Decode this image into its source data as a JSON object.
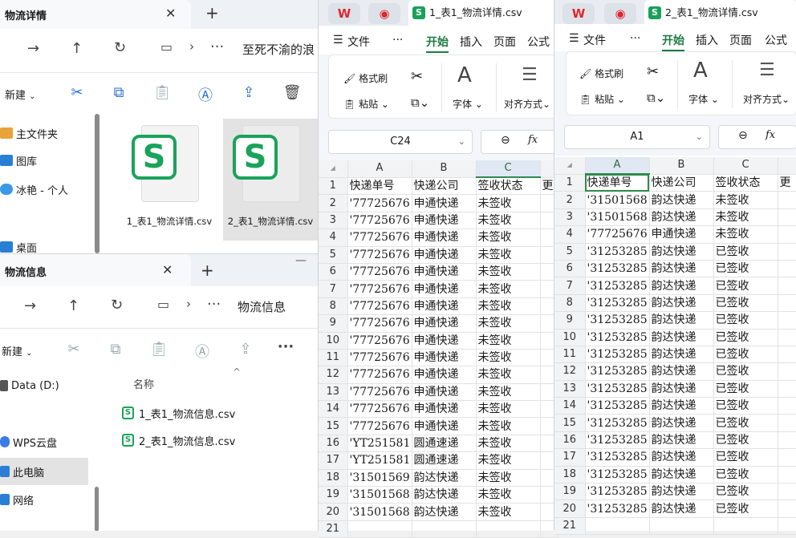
{
  "explorer1": {
    "tab_title": "物流详情",
    "address_path": "至死不渝的浪",
    "new_label": "新建",
    "sidebar": [
      {
        "label": "主文件夹",
        "icon": "home-icon"
      },
      {
        "label": "图库",
        "icon": "gallery-icon"
      },
      {
        "label": "冰艳 - 个人",
        "icon": "cloud-icon"
      },
      {
        "label": "桌面",
        "icon": "desktop-icon"
      }
    ],
    "files": [
      {
        "name": "1_表1_物流详情.csv"
      },
      {
        "name": "2_表1_物流详情.csv"
      }
    ]
  },
  "explorer2": {
    "tab_title": "物流信息",
    "address_path": "物流信息",
    "new_label": "新建",
    "column_name": "名称",
    "sidebar": [
      {
        "label": "Data (D:)",
        "icon": "drive-icon"
      },
      {
        "label": "WPS云盘",
        "icon": "cloud-icon"
      },
      {
        "label": "此电脑",
        "icon": "pc-icon"
      },
      {
        "label": "网络",
        "icon": "network-icon"
      }
    ],
    "files": [
      {
        "name": "1_表1_物流信息.csv"
      },
      {
        "name": "2_表1_物流信息.csv"
      }
    ]
  },
  "sheet1": {
    "tab_title": "1_表1_物流详情.csv",
    "menus": [
      "文件",
      "开始",
      "插入",
      "页面",
      "公式"
    ],
    "ribbon": {
      "format_painter": "格式刷",
      "paste": "粘贴",
      "font": "字体",
      "align": "对齐方式"
    },
    "name_box": "C24",
    "fx": "fx",
    "columns": [
      "A",
      "B",
      "C"
    ],
    "rows": [
      [
        "快递单号",
        "快递公司",
        "签收状态"
      ],
      [
        "'77725676",
        "申通快递",
        "未签收"
      ],
      [
        "'77725676",
        "申通快递",
        "未签收"
      ],
      [
        "'77725676",
        "申通快递",
        "未签收"
      ],
      [
        "'77725676",
        "申通快递",
        "未签收"
      ],
      [
        "'77725676",
        "申通快递",
        "未签收"
      ],
      [
        "'77725676",
        "申通快递",
        "未签收"
      ],
      [
        "'77725676",
        "申通快递",
        "未签收"
      ],
      [
        "'77725676",
        "申通快递",
        "未签收"
      ],
      [
        "'77725676",
        "申通快递",
        "未签收"
      ],
      [
        "'77725676",
        "申通快递",
        "未签收"
      ],
      [
        "'77725676",
        "申通快递",
        "未签收"
      ],
      [
        "'77725676",
        "申通快递",
        "未签收"
      ],
      [
        "'77725676",
        "申通快递",
        "未签收"
      ],
      [
        "'77725676",
        "申通快递",
        "未签收"
      ],
      [
        "'YT251581",
        "圆通速递",
        "未签收"
      ],
      [
        "'YT251581",
        "圆通速递",
        "未签收"
      ],
      [
        "'31501569",
        "韵达快递",
        "未签收"
      ],
      [
        "'31501568",
        "韵达快递",
        "未签收"
      ],
      [
        "'31501568",
        "韵达快递",
        "未签收"
      ],
      [
        "",
        "",
        ""
      ]
    ],
    "col_d_header": "更"
  },
  "sheet2": {
    "tab_title": "2_表1_物流详情.csv",
    "menus": [
      "文件",
      "开始",
      "插入",
      "页面",
      "公式"
    ],
    "ribbon": {
      "format_painter": "格式刷",
      "paste": "粘贴",
      "font": "字体",
      "align": "对齐方式"
    },
    "name_box": "A1",
    "fx": "fx",
    "columns": [
      "A",
      "B",
      "C"
    ],
    "rows": [
      [
        "快递单号",
        "快递公司",
        "签收状态"
      ],
      [
        "'31501568",
        "韵达快递",
        "未签收"
      ],
      [
        "'31501568",
        "韵达快递",
        "未签收"
      ],
      [
        "'77725676",
        "申通快递",
        "未签收"
      ],
      [
        "'31253285",
        "韵达快递",
        "已签收"
      ],
      [
        "'31253285",
        "韵达快递",
        "已签收"
      ],
      [
        "'31253285",
        "韵达快递",
        "已签收"
      ],
      [
        "'31253285",
        "韵达快递",
        "已签收"
      ],
      [
        "'31253285",
        "韵达快递",
        "已签收"
      ],
      [
        "'31253285",
        "韵达快递",
        "已签收"
      ],
      [
        "'31253285",
        "韵达快递",
        "已签收"
      ],
      [
        "'31253285",
        "韵达快递",
        "已签收"
      ],
      [
        "'31253285",
        "韵达快递",
        "已签收"
      ],
      [
        "'31253285",
        "韵达快递",
        "已签收"
      ],
      [
        "'31253285",
        "韵达快递",
        "已签收"
      ],
      [
        "'31253285",
        "韵达快递",
        "已签收"
      ],
      [
        "'31253285",
        "韵达快递",
        "已签收"
      ],
      [
        "'31253285",
        "韵达快递",
        "已签收"
      ],
      [
        "'31253285",
        "韵达快递",
        "已签收"
      ],
      [
        "'31253285",
        "韵达快递",
        "已签收"
      ],
      [
        "",
        "",
        ""
      ]
    ],
    "col_d_header": "更"
  }
}
